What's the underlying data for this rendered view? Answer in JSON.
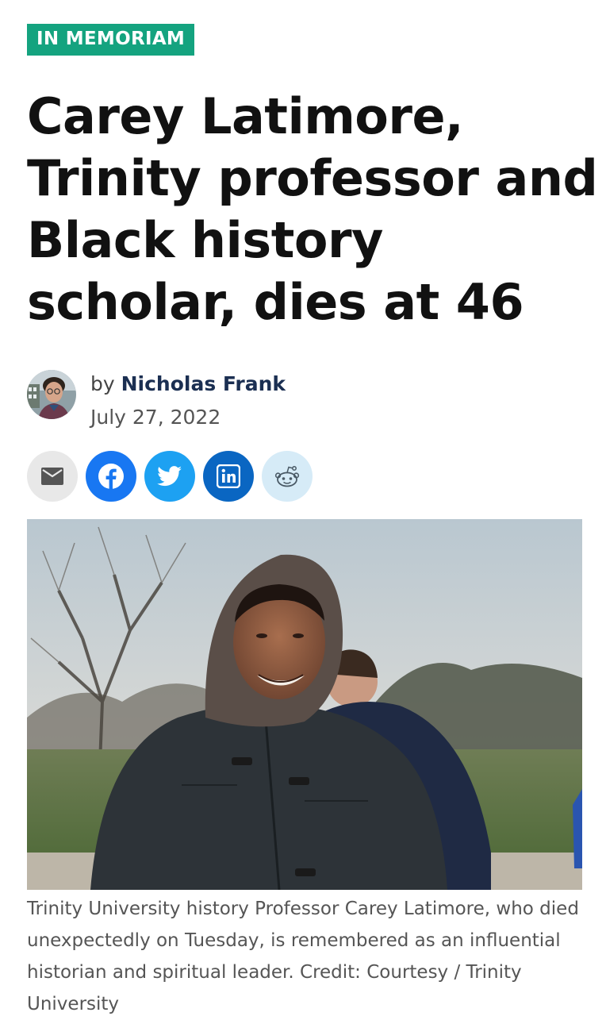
{
  "article": {
    "category": "IN MEMORIAM",
    "headline": "Carey Latimore, Trinity professor and Black history scholar, dies at 46",
    "byline_prefix": "by",
    "author": "Nicholas Frank",
    "date": "July 27, 2022",
    "photo_caption": "Trinity University history Professor Carey Latimore, who died unexpectedly on Tuesday, is remembered as an influential historian and spiritual leader. Credit: Courtesy / Trinity University"
  },
  "share": [
    {
      "name": "email",
      "icon": "email-icon",
      "color": "#e8e8e8"
    },
    {
      "name": "facebook",
      "icon": "facebook-icon",
      "color": "#1877f2"
    },
    {
      "name": "twitter",
      "icon": "twitter-icon",
      "color": "#1da1f2"
    },
    {
      "name": "linkedin",
      "icon": "linkedin-icon",
      "color": "#0a66c2"
    },
    {
      "name": "reddit",
      "icon": "reddit-icon",
      "color": "#d6ebf7"
    }
  ],
  "colors": {
    "badge": "#14a37f",
    "author": "#1b2f52",
    "headline": "#111111"
  }
}
